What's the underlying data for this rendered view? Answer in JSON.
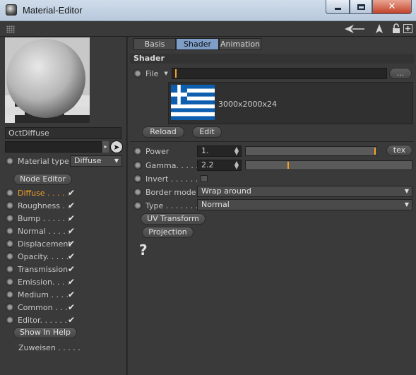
{
  "window": {
    "title": "Material-Editor",
    "close_glyph": "✕"
  },
  "toolbar_icons": [
    "back-arrow-icon",
    "pointer-icon",
    "lock-icon",
    "new-window-icon"
  ],
  "left": {
    "material_name": "OctDiffuse",
    "material_type_label": "Material type",
    "material_type_value": "Diffuse",
    "node_editor_label": "Node Editor",
    "channels": [
      {
        "label": "Diffuse . . . . .",
        "active": true
      },
      {
        "label": "Roughness . .",
        "active": false
      },
      {
        "label": "Bump . . . . . .",
        "active": false
      },
      {
        "label": "Normal . . . . .",
        "active": false
      },
      {
        "label": "Displacement",
        "active": false
      },
      {
        "label": "Opacity. . . . .",
        "active": false
      },
      {
        "label": "Transmission",
        "active": false
      },
      {
        "label": "Emission. . . .",
        "active": false
      },
      {
        "label": "Medium . . . .",
        "active": false
      },
      {
        "label": "Common  . . .",
        "active": false
      },
      {
        "label": "Editor. . . . . .",
        "active": false
      }
    ],
    "check_glyph": "✔",
    "show_in_help_label": "Show In Help",
    "assign_label": "Zuweisen . . . . ."
  },
  "tabs": [
    {
      "label": "Basis",
      "active": false
    },
    {
      "label": "Shader",
      "active": true
    },
    {
      "label": "Animation",
      "active": false
    }
  ],
  "shader": {
    "section_title": "Shader",
    "file_label": "File",
    "file_value": "",
    "browse_label": "...",
    "image_info": "3000x2000x24",
    "reload_label": "Reload",
    "edit_label": "Edit",
    "power_label": "Power",
    "power_value": "1.",
    "power_level": 1.0,
    "tex_label": "tex",
    "gamma_label": "Gamma. . . . .",
    "gamma_value": "2.2",
    "gamma_level": 0.25,
    "invert_label": "Invert . . . . . .",
    "border_mode_label": "Border mode",
    "border_mode_value": "Wrap around",
    "type_label": "Type . . . . . . .",
    "type_value": "Normal",
    "uv_transform_label": "UV Transform",
    "projection_label": "Projection",
    "help_glyph": "?"
  },
  "colors": {
    "accent": "#f0a028",
    "active_tab": "#7e9ec7",
    "flag_blue": "#0d5eaf"
  }
}
